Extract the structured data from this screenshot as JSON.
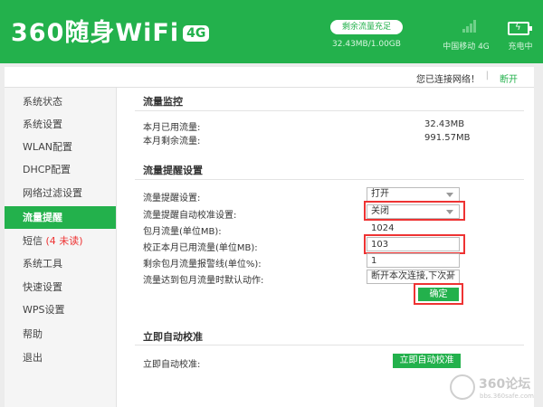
{
  "header": {
    "logo_text": "360随身WiFi",
    "logo_badge": "4G",
    "data_pill": "剩余流量充足",
    "data_usage": "32.43MB/1.00GB",
    "carrier": "中国移动 4G",
    "charge_status": "充电中"
  },
  "topbar": {
    "connection_status": "您已连接网络！",
    "separator": "|",
    "disconnect_label": "断开"
  },
  "sidebar": {
    "items": [
      {
        "label": "系统状态"
      },
      {
        "label": "系统设置"
      },
      {
        "label": "WLAN配置"
      },
      {
        "label": "DHCP配置"
      },
      {
        "label": "网络过滤设置"
      },
      {
        "label": "流量提醒"
      },
      {
        "label": "短信",
        "badge": "(4 未读)"
      },
      {
        "label": "系统工具"
      },
      {
        "label": "快速设置"
      },
      {
        "label": "WPS设置"
      },
      {
        "label": "帮助"
      },
      {
        "label": "退出"
      }
    ]
  },
  "monitor": {
    "title": "流量监控",
    "used_label": "本月已用流量:",
    "used_value": "32.43MB",
    "remaining_label": "本月剩余流量:",
    "remaining_value": "991.57MB"
  },
  "reminder": {
    "title": "流量提醒设置",
    "reminder_setting_label": "流量提醒设置:",
    "reminder_setting_value": "打开",
    "auto_calibrate_label": "流量提醒自动校准设置:",
    "auto_calibrate_value": "关闭",
    "monthly_label": "包月流量(单位MB):",
    "monthly_value": "1024",
    "corrected_used_label": "校正本月已用流量(单位MB):",
    "corrected_used_value": "103",
    "warning_label": "剩余包月流量报警线(单位%):",
    "warning_value": "1",
    "action_label": "流量达到包月流量时默认动作:",
    "action_value": "断开本次连接,下次开",
    "confirm_label": "确定"
  },
  "calibrate": {
    "title": "立即自动校准",
    "label": "立即自动校准:",
    "button_label": "立即自动校准"
  },
  "watermark": {
    "title": "360论坛",
    "url": "bbs.360safe.com"
  },
  "colors": {
    "brand_green": "#23b14c",
    "highlight_red": "#e33333"
  }
}
